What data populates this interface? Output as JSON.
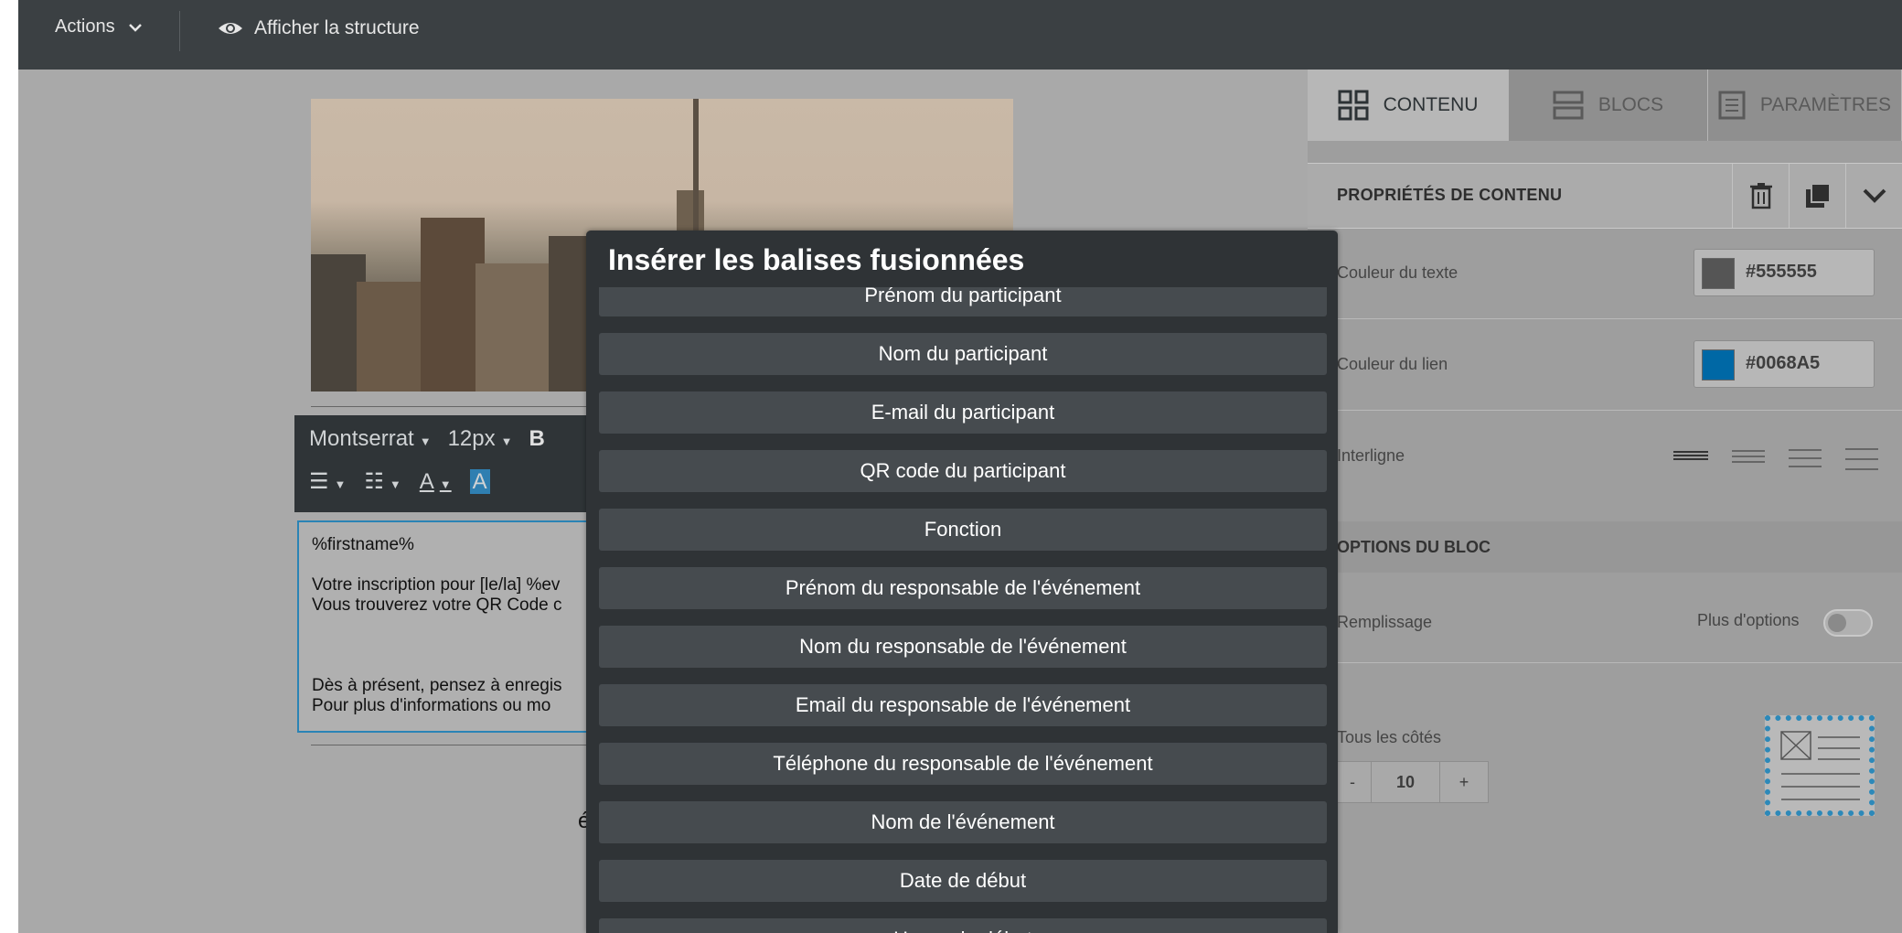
{
  "topbar": {
    "actions_label": "Actions",
    "structure_label": "Afficher la structure"
  },
  "editor": {
    "toolbar": {
      "font": "Montserrat",
      "size": "12px",
      "bold": "B"
    },
    "text_lines": [
      "%firstname%",
      "",
      "Votre inscription pour [le/la] %ev",
      "Vous trouverez votre QR Code c",
      "",
      "",
      "",
      "Dès à présent, pensez à enregis",
      "Pour plus d'informations ou mo"
    ],
    "below_fragment": "é"
  },
  "right_panel": {
    "tabs": [
      {
        "label": "CONTENU",
        "icon": "grid-icon",
        "active": true
      },
      {
        "label": "BLOCS",
        "icon": "blocks-icon",
        "active": false
      },
      {
        "label": "PARAMÈTRES",
        "icon": "settings-doc-icon",
        "active": false
      }
    ],
    "props_title": "PROPRIÉTÉS DE CONTENU",
    "text_color_label": "Couleur du texte",
    "text_color_value": "#555555",
    "link_color_label": "Couleur du lien",
    "link_color_value": "#0068A5",
    "line_height_label": "Interligne",
    "block_options_title": "OPTIONS DU BLOC",
    "padding_label": "Remplissage",
    "more_options_label": "Plus d'options",
    "all_sides_label": "Tous les côtés",
    "stepper_minus": "-",
    "stepper_value": "10",
    "stepper_plus": "+"
  },
  "modal": {
    "title": "Insérer les balises fusionnées",
    "items": [
      "Prénom du participant",
      "Nom du participant",
      "E-mail du participant",
      "QR code du participant",
      "Fonction",
      "Prénom du responsable de l'événement",
      "Nom du responsable de l'événement",
      "Email du responsable de l'événement",
      "Téléphone du responsable de l'événement",
      "Nom de l'événement",
      "Date de début",
      "Heure de début"
    ]
  }
}
